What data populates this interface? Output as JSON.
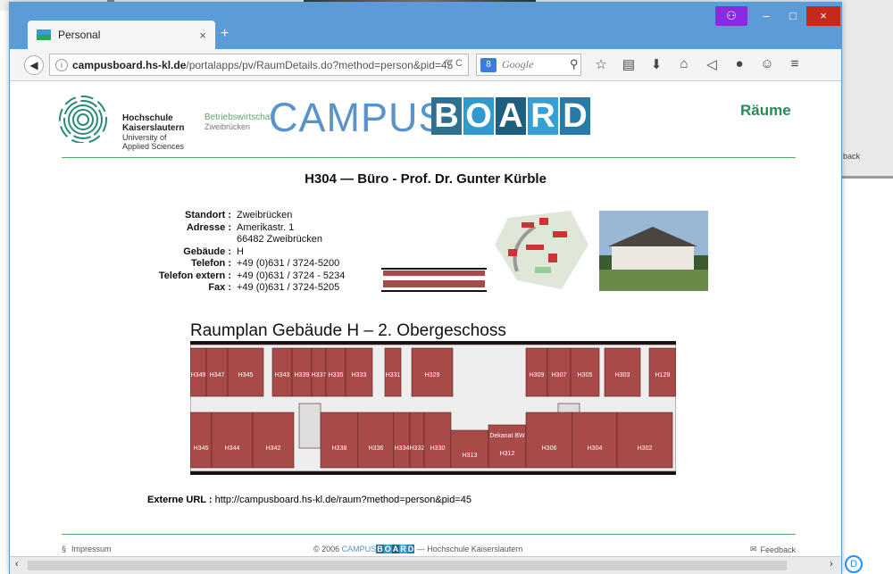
{
  "browser": {
    "tab_title": "Personal",
    "tab_close": "×",
    "new_tab": "+",
    "url_host": "campusboard.hs-kl.de",
    "url_path": "/portalapps/pv/RaumDetails.do?method=person&pid=45",
    "url_controls": "▽ C",
    "search_engine_badge": "8",
    "search_placeholder": "Google",
    "window_controls": {
      "minimize": "–",
      "maximize": "□",
      "close": "×",
      "mask": "⚇"
    },
    "toolbar_icons": [
      "star-icon",
      "reader-icon",
      "download-icon",
      "home-icon",
      "send-icon",
      "abp-icon",
      "chat-icon",
      "menu-icon"
    ]
  },
  "header": {
    "hs_line1": "Hochschule",
    "hs_line2": "Kaiserslautern",
    "hs_line3": "University of",
    "hs_line4": "Applied Sciences",
    "bwl_line1": "Betriebswirtschaft",
    "bwl_line2": "Zweibrücken",
    "campus": "CAMPUS",
    "board_letters": [
      "B",
      "O",
      "A",
      "R",
      "D"
    ],
    "board_colors": [
      "#2f6f8f",
      "#2f9ad0",
      "#1e5f80",
      "#35a0d6",
      "#2a7aa8"
    ],
    "section": "Räume"
  },
  "room": {
    "title": "H304 — Büro - Prof. Dr. Gunter Kürble",
    "fields": [
      {
        "label": "Standort :",
        "value": "Zweibrücken"
      },
      {
        "label": "Adresse :",
        "value": "Amerikastr. 1"
      },
      {
        "label": "",
        "value": "66482 Zweibrücken"
      },
      {
        "label": "Gebäude :",
        "value": "H"
      },
      {
        "label": "Telefon :",
        "value": "+49 (0)631 / 3724-5200"
      },
      {
        "label": "Telefon extern :",
        "value": "+49 (0)631 / 3724 - 5234"
      },
      {
        "label": "Fax :",
        "value": "+49 (0)631 / 3724-5205"
      }
    ],
    "floor_thumb_caption": "Raumplan Gebäude H – 2. Obergeschoss"
  },
  "plan": {
    "title": "Raumplan Gebäude H – 2. Obergeschoss",
    "top_rooms": [
      "H349",
      "H347",
      "H345",
      "H343",
      "H339",
      "H337",
      "H335",
      "H333",
      "H331",
      "H329",
      "H309",
      "H307",
      "H305",
      "H303",
      "H129"
    ],
    "bottom_rooms": [
      "H346",
      "H344",
      "H342",
      "H338",
      "H336",
      "H334",
      "H332",
      "H330",
      "H313",
      "Dekanat BW",
      "H312",
      "H306",
      "H304",
      "H302"
    ],
    "room_color": "#a84a48"
  },
  "external": {
    "label": "Externe URL :",
    "url": "http://campusboard.hs-kl.de/raum?method=person&pid=45"
  },
  "footer": {
    "impressum": "Impressum",
    "copyright_prefix": "© 2006",
    "copyright_campus": "CAMPUS",
    "copyright_suffix": "— Hochschule Kaiserslautern",
    "feedback": "Feedback"
  },
  "background": {
    "right_text": "back"
  }
}
